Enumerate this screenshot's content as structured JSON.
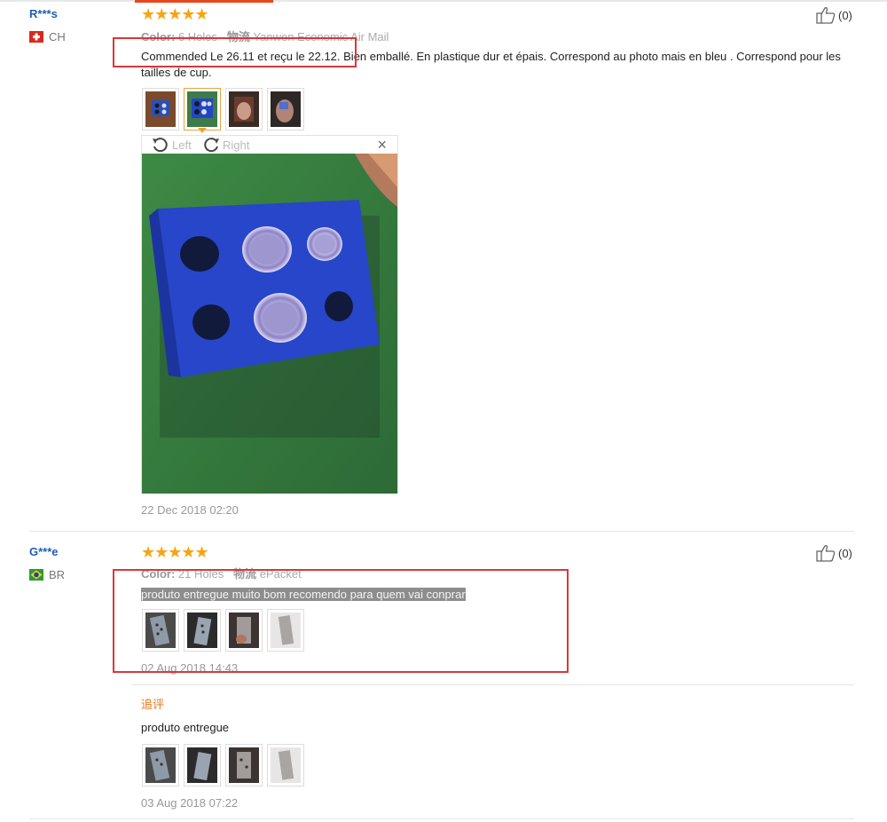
{
  "reviews": [
    {
      "user": "R***s",
      "country": "CH",
      "stars": "★★★★★",
      "color_label": "Color:",
      "color_value": "6 Holes",
      "shipping_label": "物流",
      "shipping_value": "Yanwen Economic Air Mail",
      "text": "Commended Le 26.11 et reçu le 22.12. Bien emballé. En plastique dur et épais. Correspond au photo mais en bleu . Correspond pour les tailles de cup.",
      "likes": "(0)",
      "date": "22 Dec 2018 02:20",
      "viewer": {
        "left": "Left",
        "right": "Right",
        "close": "×"
      }
    },
    {
      "user": "G***e",
      "country": "BR",
      "stars": "★★★★★",
      "color_label": "Color:",
      "color_value": "21 Holes",
      "shipping_label": "物流",
      "shipping_value": "ePacket",
      "text": "produto entregue muito bom recomendo para quem vai conprar",
      "likes": "(0)",
      "date": "02 Aug 2018 14:43",
      "followup": {
        "label": "追评",
        "text": "produto entregue",
        "date": "03 Aug 2018 07:22"
      }
    }
  ],
  "colors": {
    "accent": "#e8471b",
    "star": "#f7a414",
    "link": "#1c5fb3",
    "annotation": "#d9383a"
  }
}
